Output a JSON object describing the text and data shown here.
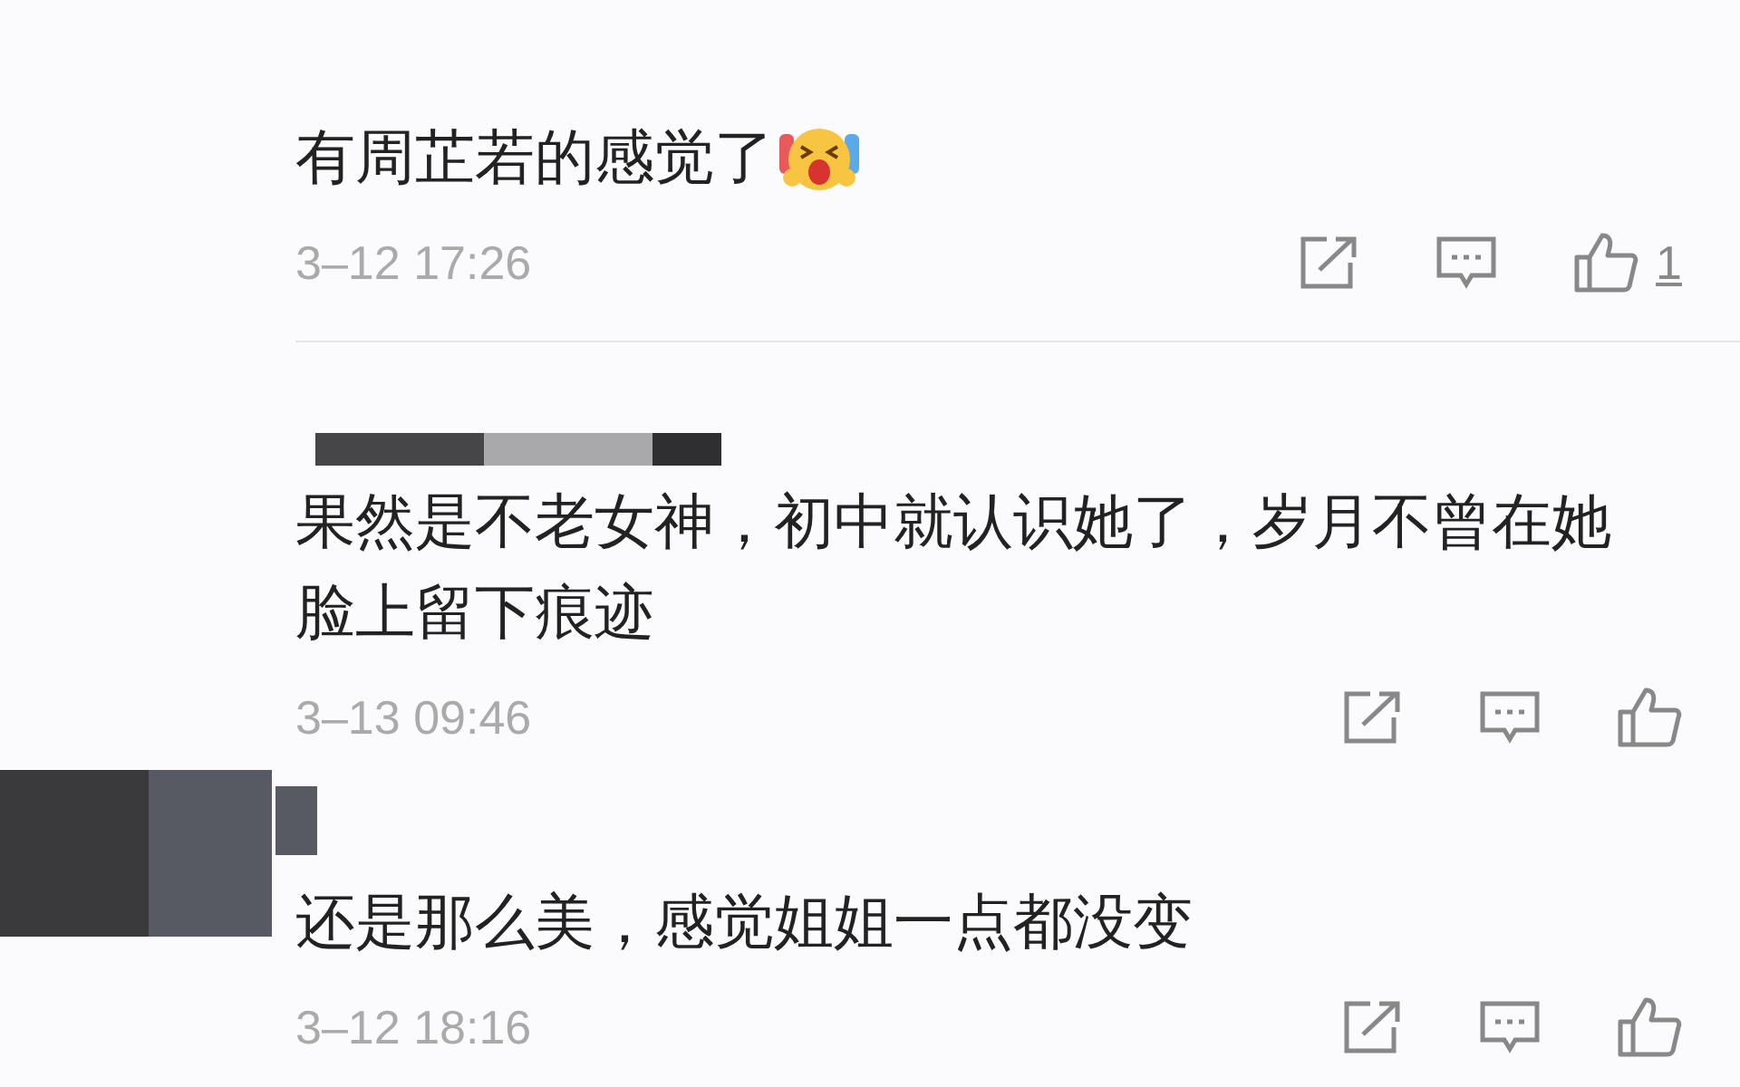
{
  "comments": [
    {
      "text": "有周芷若的感觉了",
      "emoji": true,
      "time": "3–12 17:26",
      "likes": "1",
      "rule_above": false
    },
    {
      "author": {
        "kind": "bar"
      },
      "text": "果然是不老女神，初中就认识她了，岁月不曾在她脸上留下痕迹",
      "emoji": false,
      "time": "3–13 09:46",
      "rule_above": true
    },
    {
      "author": {
        "kind": "block"
      },
      "text": "还是那么美，感觉姐姐一点都没变",
      "emoji": false,
      "time": "3–12 18:16",
      "rule_above": false
    }
  ]
}
